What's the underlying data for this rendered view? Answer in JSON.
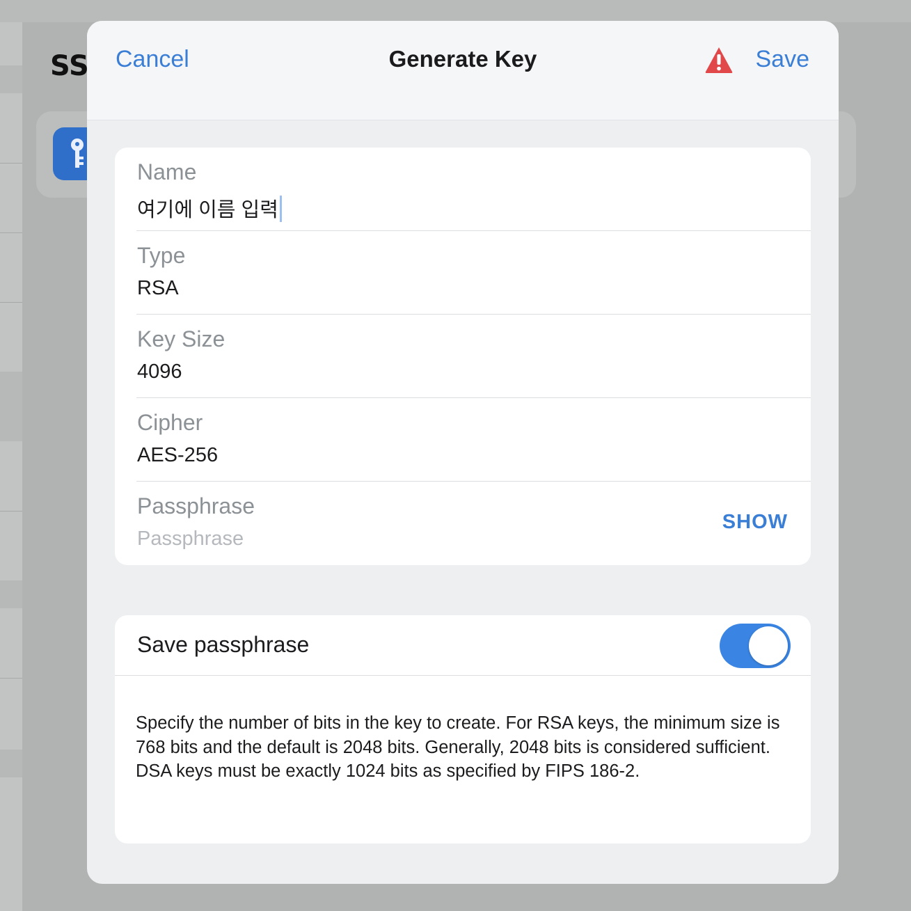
{
  "background": {
    "title": "SS",
    "key_icon": "key-icon"
  },
  "sheet": {
    "cancel_label": "Cancel",
    "title": "Generate Key",
    "warning_icon": "warning-triangle-icon",
    "save_label": "Save"
  },
  "form": {
    "name": {
      "label": "Name",
      "value": "여기에 이름 입력"
    },
    "type": {
      "label": "Type",
      "value": "RSA"
    },
    "key_size": {
      "label": "Key Size",
      "value": "4096"
    },
    "cipher": {
      "label": "Cipher",
      "value": "AES-256"
    },
    "passphrase": {
      "label": "Passphrase",
      "placeholder": "Passphrase",
      "show_label": "SHOW"
    }
  },
  "options": {
    "save_passphrase": {
      "label": "Save passphrase",
      "enabled": true
    },
    "help_text": "Specify the number of bits in the key to create. For RSA keys, the minimum size is 768 bits and the default is 2048 bits. Generally, 2048 bits is considered sufficient. DSA keys must be exactly 1024 bits as specified by FIPS 186-2."
  },
  "colors": {
    "accent": "#3a7fd5",
    "warning": "#e0484a",
    "toggle_on": "#3a85e3"
  }
}
